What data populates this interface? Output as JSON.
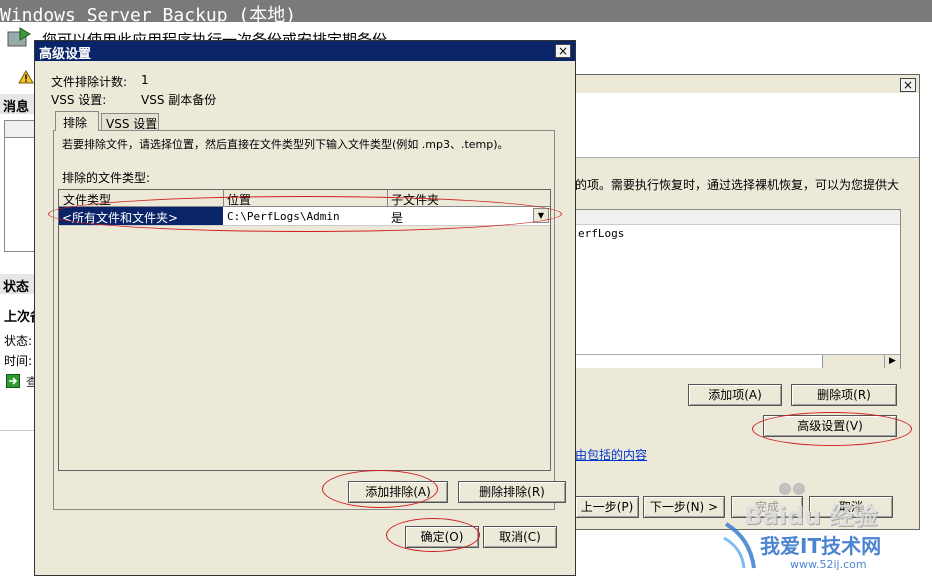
{
  "app": {
    "title": "Windows Server Backup (本地)",
    "intro_text": "您可以使用此应用程序执行一次备份或安排定期备份",
    "messages_heading": "消息 (",
    "status_heading": "状态",
    "last_backup_heading": "上次备",
    "status_label": "状态:",
    "time_label": "时间:",
    "view_link_fragment": "查"
  },
  "wizard": {
    "description": "的项。需要执行恢复时，通过选择裸机恢复，可以为您提供大",
    "list_item": "erfLogs",
    "add_item_button": "添加项(A)",
    "remove_item_button": "删除项(R)",
    "advanced_button": "高级设置(V)",
    "link_fragment": "由包括的内容",
    "prev_button": "上一步(P)",
    "next_button": "下一步(N) >",
    "finish_button": "完成",
    "cancel_button": "取消"
  },
  "dialog": {
    "title": "高级设置",
    "exclusion_count_label": "文件排除计数:",
    "exclusion_count_value": "1",
    "vss_label": "VSS 设置:",
    "vss_value": "VSS 副本备份",
    "tabs": [
      {
        "label": "排除"
      },
      {
        "label": "VSS 设置"
      }
    ],
    "instruction": "若要排除文件，请选择位置，然后直接在文件类型列下输入文件类型(例如 .mp3、.temp)。",
    "excluded_types_label": "排除的文件类型:",
    "columns": [
      "文件类型",
      "位置",
      "子文件夹"
    ],
    "row": {
      "file_type": "<所有文件和文件夹>",
      "location": "C:\\PerfLogs\\Admin",
      "subfolders": "是"
    },
    "add_exclusion_button": "添加排除(A)",
    "remove_exclusion_button": "删除排除(R)",
    "ok_button": "确定(O)",
    "cancel_button": "取消(C)"
  },
  "watermark": {
    "brand": "Baidu 经验",
    "site_title": "我爱IT技术网",
    "site_url": "www.52ij.com"
  },
  "colors": {
    "selection": "#0a246a",
    "dialog_face": "#ece9d8",
    "annotation": "#d02020"
  }
}
